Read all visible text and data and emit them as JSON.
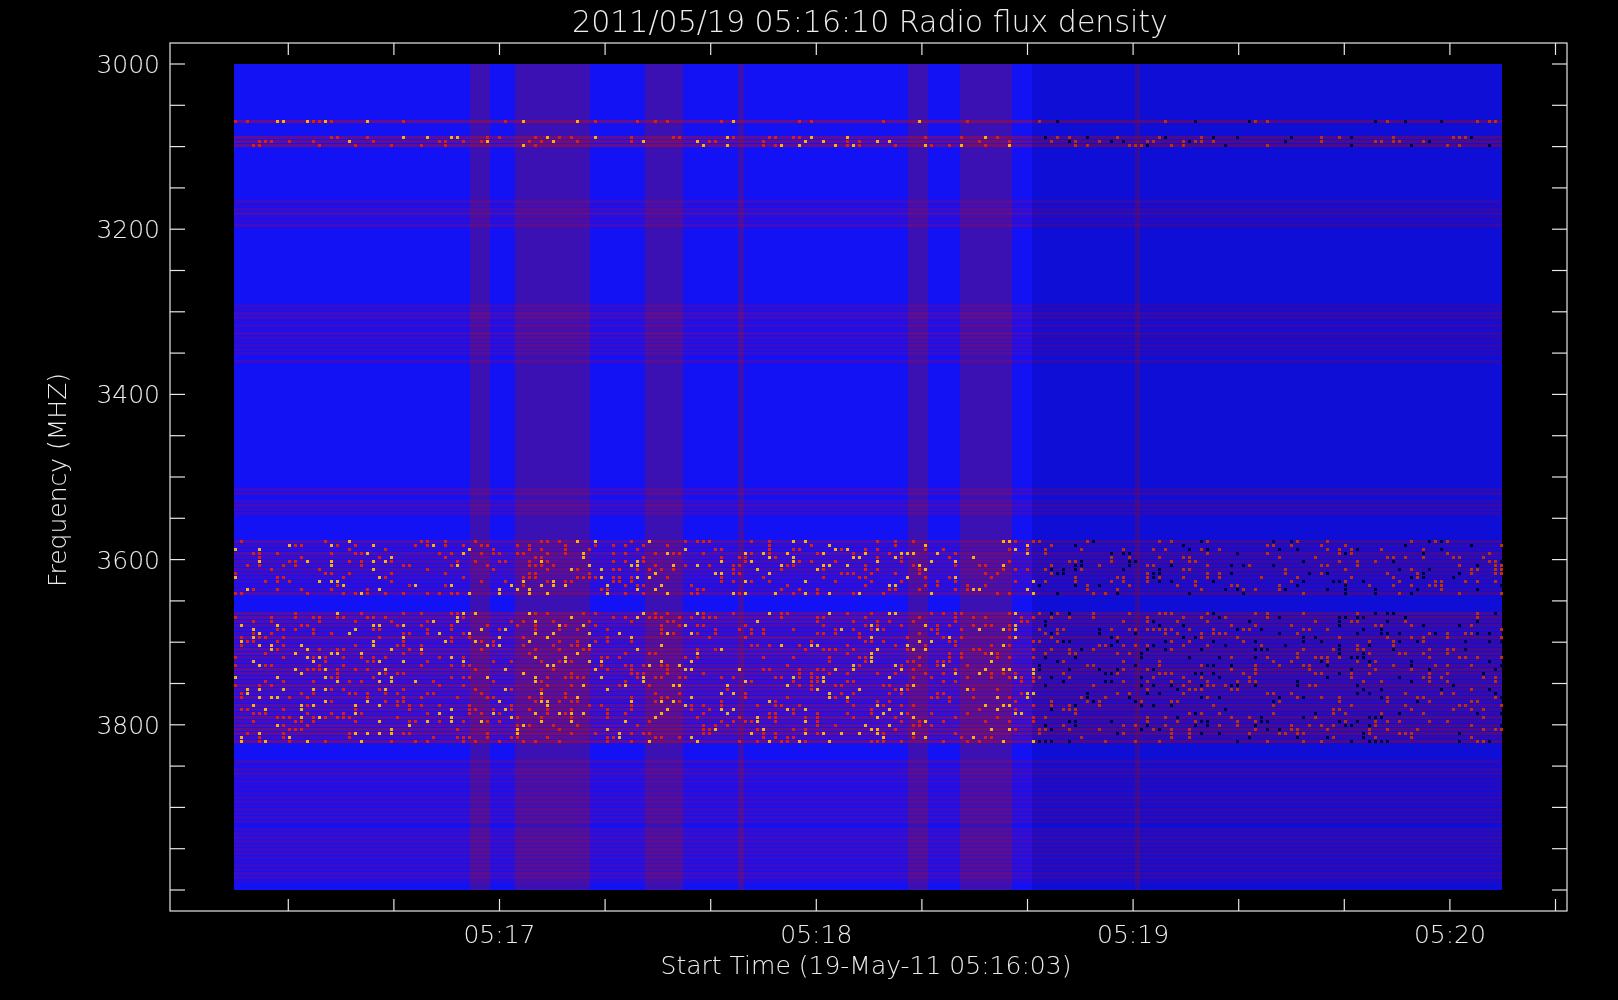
{
  "plot": {
    "title": "2011/05/19 05:16:10 Radio flux density",
    "y_axis": {
      "label": "Frequency (MHZ)",
      "ticks": [
        "3000",
        "3200",
        "3400",
        "3600",
        "3800"
      ]
    },
    "x_axis": {
      "label": "Start Time (19-May-11 05:16:03)",
      "ticks": [
        "05:17",
        "05:18",
        "05:19",
        "05:20"
      ]
    }
  }
}
